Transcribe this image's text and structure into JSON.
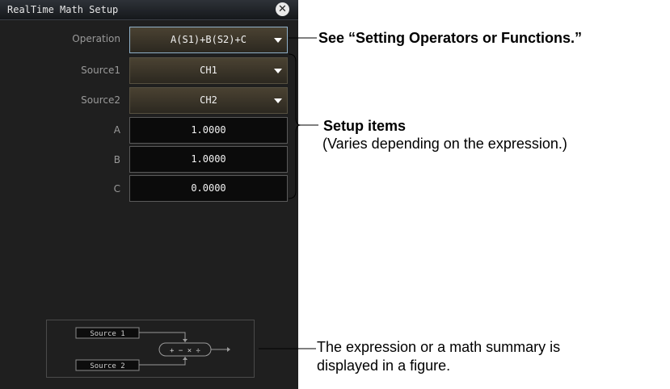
{
  "dialog": {
    "title": "RealTime Math Setup",
    "rows": [
      {
        "label": "Operation",
        "value": "A(S1)+B(S2)+C",
        "kind": "dropdown"
      },
      {
        "label": "Source1",
        "value": "CH1",
        "kind": "dropdown"
      },
      {
        "label": "Source2",
        "value": "CH2",
        "kind": "dropdown"
      },
      {
        "label": "A",
        "value": "1.0000",
        "kind": "number"
      },
      {
        "label": "B",
        "value": "1.0000",
        "kind": "number"
      },
      {
        "label": "C",
        "value": "0.0000",
        "kind": "number"
      }
    ],
    "diagram": {
      "source1": "Source 1",
      "source2": "Source 2",
      "operators": "+ − × ÷"
    }
  },
  "annotations": {
    "operators_note": "See “Setting Operators or Functions.”",
    "setup_title": "Setup items",
    "setup_sub": "(Varies depending on the expression.)",
    "figure_note_line1": "The expression or a math summary is",
    "figure_note_line2": "displayed in a figure."
  }
}
